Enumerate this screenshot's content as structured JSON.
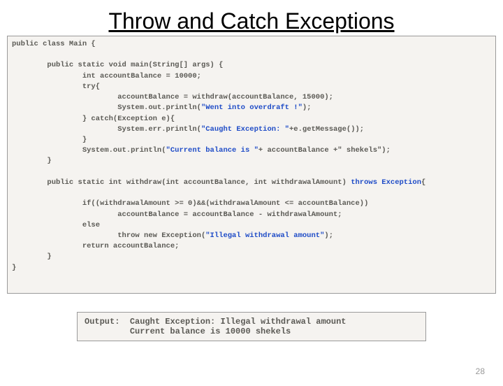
{
  "title": "Throw and Catch Exceptions",
  "code": {
    "l1": "public class Main {",
    "l2": "",
    "l3a": "        public static void main(String[] args) {",
    "l4": "                int accountBalance = 10000;",
    "l5": "                try{",
    "l6": "                        accountBalance = withdraw(accountBalance, 15000);",
    "l7a": "                        System.out.println(",
    "l7s": "\"Went into overdraft !\"",
    "l7b": ");",
    "l8": "                } catch(Exception e){",
    "l9a": "                        System.err.println(",
    "l9s": "\"Caught Exception: \"",
    "l9b": "+e.getMessage());",
    "l10": "                }",
    "l11a": "                System.out.println(",
    "l11s": "\"Current balance is \"",
    "l11b": "+ accountBalance +\" shekels\");",
    "l12": "        }",
    "l13": "",
    "l14a": "        public static int withdraw(int accountBalance, int withdrawalAmount) ",
    "l14b": "throws Exception",
    "l14c": "{",
    "l15": "",
    "l16": "                if((withdrawalAmount >= 0)&&(withdrawalAmount <= accountBalance))",
    "l17": "                        accountBalance = accountBalance - withdrawalAmount;",
    "l18": "                else",
    "l19a": "                        throw new Exception(",
    "l19s": "\"Illegal withdrawal amount\"",
    "l19b": ");",
    "l20": "                return accountBalance;",
    "l21": "        }",
    "l22": "}"
  },
  "output": {
    "label": "Output:",
    "line1": "Caught Exception: Illegal withdrawal amount",
    "line2": "Current balance is 10000 shekels"
  },
  "page_number": "28"
}
